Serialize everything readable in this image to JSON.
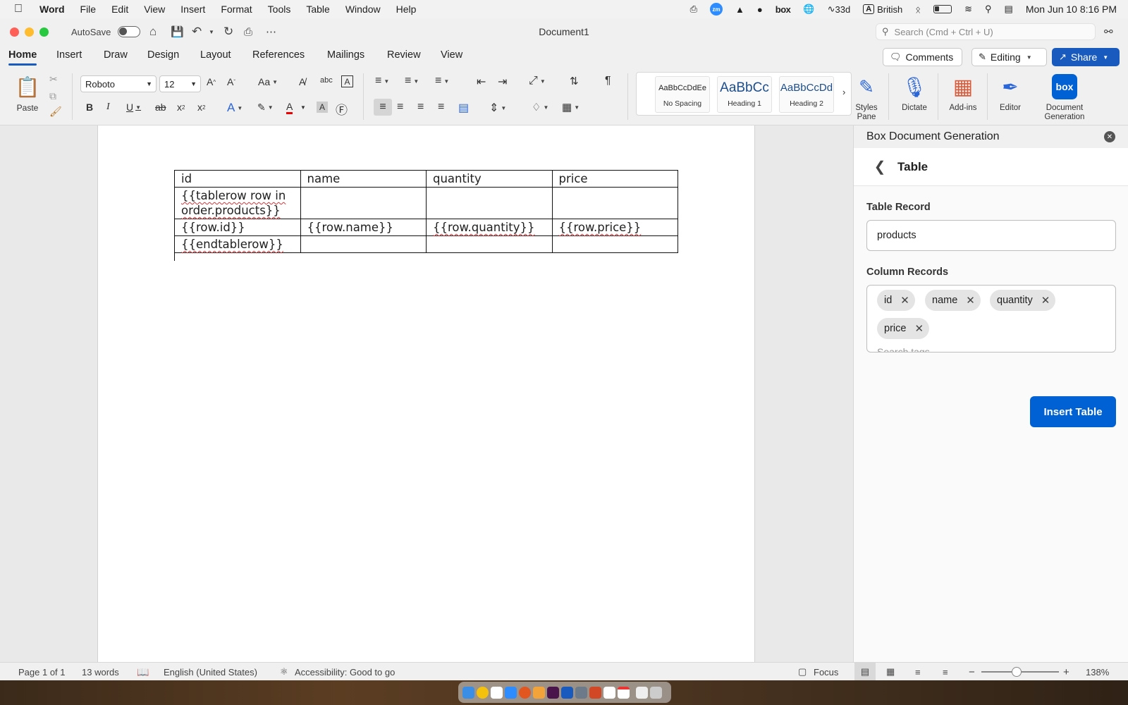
{
  "menubar": {
    "app_name": "Word",
    "items": [
      "File",
      "Edit",
      "View",
      "Insert",
      "Format",
      "Tools",
      "Table",
      "Window",
      "Help"
    ],
    "tray_zoom": "zm",
    "tray_box": "box",
    "tray_timer": "33d",
    "tray_lang_badge": "A",
    "tray_lang": "British",
    "datetime": "Mon Jun 10  8:16 PM"
  },
  "titlebar": {
    "autosave_label": "AutoSave",
    "doc_title": "Document1",
    "search_placeholder": "Search (Cmd + Ctrl + U)"
  },
  "tabs": {
    "items": [
      "Home",
      "Insert",
      "Draw",
      "Design",
      "Layout",
      "References",
      "Mailings",
      "Review",
      "View"
    ],
    "active": "Home",
    "comments_label": "Comments",
    "editing_label": "Editing",
    "share_label": "Share"
  },
  "ribbon": {
    "paste_label": "Paste",
    "font_name": "Roboto",
    "font_size": "12",
    "styles": [
      {
        "sample": "AaBbCcDdEe",
        "name": "No Spacing"
      },
      {
        "sample": "AaBbCc",
        "name": "Heading 1"
      },
      {
        "sample": "AaBbCcDd",
        "name": "Heading 2"
      }
    ],
    "styles_pane_label": "Styles Pane",
    "dictate_label": "Dictate",
    "addins_label": "Add-ins",
    "editor_label": "Editor",
    "docgen_label": "Document Generation",
    "docgen_logo": "box"
  },
  "document": {
    "table": [
      [
        "id",
        "name",
        "quantity",
        "price"
      ],
      [
        "{{tablerow row in order.products}}",
        "",
        "",
        ""
      ],
      [
        "{{row.id}}",
        "{{row.name}}",
        "{{row.quantity}}",
        "{{row.price}}"
      ],
      [
        "{{endtablerow}}",
        "",
        "",
        ""
      ]
    ]
  },
  "panel": {
    "header": "Box Document Generation",
    "title": "Table",
    "table_record_label": "Table Record",
    "table_record_value": "products",
    "column_records_label": "Column Records",
    "columns": [
      "id",
      "name",
      "quantity",
      "price"
    ],
    "tag_search_placeholder": "Search tags",
    "insert_button": "Insert Table"
  },
  "statusbar": {
    "page": "Page 1 of 1",
    "words": "13 words",
    "language": "English (United States)",
    "accessibility": "Accessibility: Good to go",
    "focus": "Focus",
    "zoom": "138%",
    "zoom_level": 0.45
  },
  "colors": {
    "accent": "#185abd",
    "box_blue": "#0061d5",
    "spell_error": "#d13438"
  }
}
